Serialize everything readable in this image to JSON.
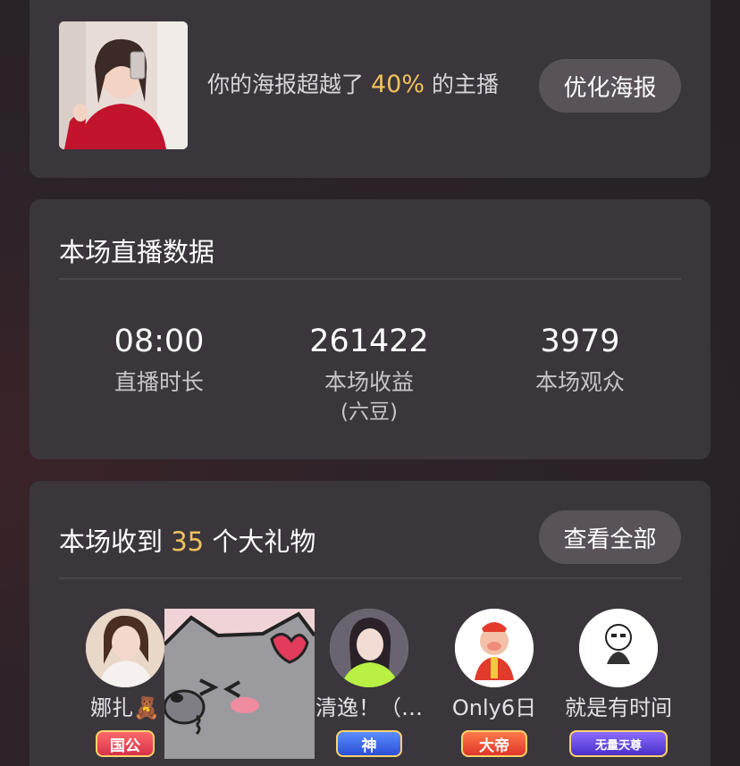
{
  "poster": {
    "text_before": "你的海报超越了",
    "percent": "40%",
    "text_after": "的主播",
    "button_label": "优化海报"
  },
  "stats": {
    "title": "本场直播数据",
    "items": [
      {
        "value": "08:00",
        "label": "直播时长",
        "sub": ""
      },
      {
        "value": "261422",
        "label": "本场收益",
        "sub": "(六豆)"
      },
      {
        "value": "3979",
        "label": "本场观众",
        "sub": ""
      }
    ]
  },
  "gifts": {
    "title_before": "本场收到",
    "count": "35",
    "title_after": "个大礼物",
    "button_label": "查看全部",
    "gifters": [
      {
        "name": "娜扎🧸",
        "badge": "国公"
      },
      {
        "name": "清逸！（…",
        "badge": "神"
      },
      {
        "name": "Only6日",
        "badge": "大帝"
      },
      {
        "name": "就是有时间",
        "badge": "无量天尊"
      }
    ]
  },
  "colors": {
    "accent": "#f2c25a",
    "card_bg": "#3b363c",
    "button_bg": "#5a5259"
  }
}
